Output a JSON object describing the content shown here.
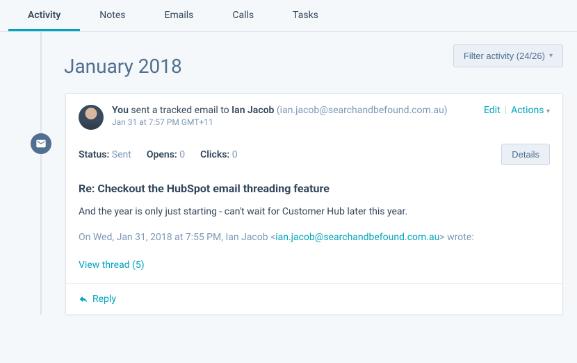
{
  "tabs": {
    "activity": "Activity",
    "notes": "Notes",
    "emails": "Emails",
    "calls": "Calls",
    "tasks": "Tasks"
  },
  "filter": {
    "label": "Filter activity (24/26)"
  },
  "date_header": "January 2018",
  "card": {
    "sender": "You",
    "action_text": " sent a tracked email to ",
    "recipient": "Ian Jacob",
    "recipient_email": " (ian.jacob@searchandbefound.com.au)",
    "timestamp": "Jan 31 at 7:57 PM GMT+11",
    "edit": "Edit",
    "actions": "Actions",
    "status_label": "Status:",
    "status_value": "Sent",
    "opens_label": "Opens:",
    "opens_value": "0",
    "clicks_label": "Clicks:",
    "clicks_value": "0",
    "details": "Details",
    "subject": "Re: Checkout the HubSpot email threading feature",
    "body": "And the year is only just starting - can't wait for Customer Hub later this year.",
    "quoted_prefix": "On Wed, Jan 31, 2018 at 7:55 PM, Ian Jacob <",
    "quoted_email": "ian.jacob@searchandbefound.com.au",
    "quoted_suffix": "> wrote:",
    "view_thread": "View thread (5)",
    "reply": "Reply"
  }
}
